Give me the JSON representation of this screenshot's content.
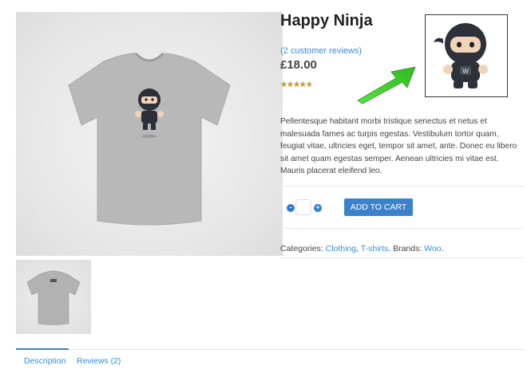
{
  "product": {
    "title": "Happy Ninja",
    "reviews_link": "(2 customer reviews)",
    "price": "£18.00",
    "rating": 5,
    "rating_max": 5,
    "description": "Pellentesque habitant morbi tristique senectus et netus et malesuada fames ac turpis egestas. Vestibulum tortor quam, feugiat vitae, ultricies eget, tempor sit amet, ante. Donec eu libero sit amet quam egestas semper. Aenean ultricies mi vitae est. Mauris placerat eleifend leo."
  },
  "cart": {
    "minus_label": "-",
    "plus_label": "+",
    "quantity": "",
    "add_to_cart_label": "ADD TO CART"
  },
  "meta": {
    "categories_label": "Categories:",
    "category_1": "Clothing",
    "category_sep": ",",
    "category_2": "T-shirts",
    "brands_label": ". Brands:",
    "brand_1": "Woo",
    "end": "."
  },
  "tabs": [
    {
      "label": "Description",
      "active": true
    },
    {
      "label": "Reviews (2)",
      "active": false
    }
  ],
  "icons": {
    "arrow": "green-arrow-icon",
    "ninja": "ninja-logo-icon"
  },
  "colors": {
    "link": "#3a8bd6",
    "button": "#3a83cc",
    "arrow": "#39d12a"
  }
}
